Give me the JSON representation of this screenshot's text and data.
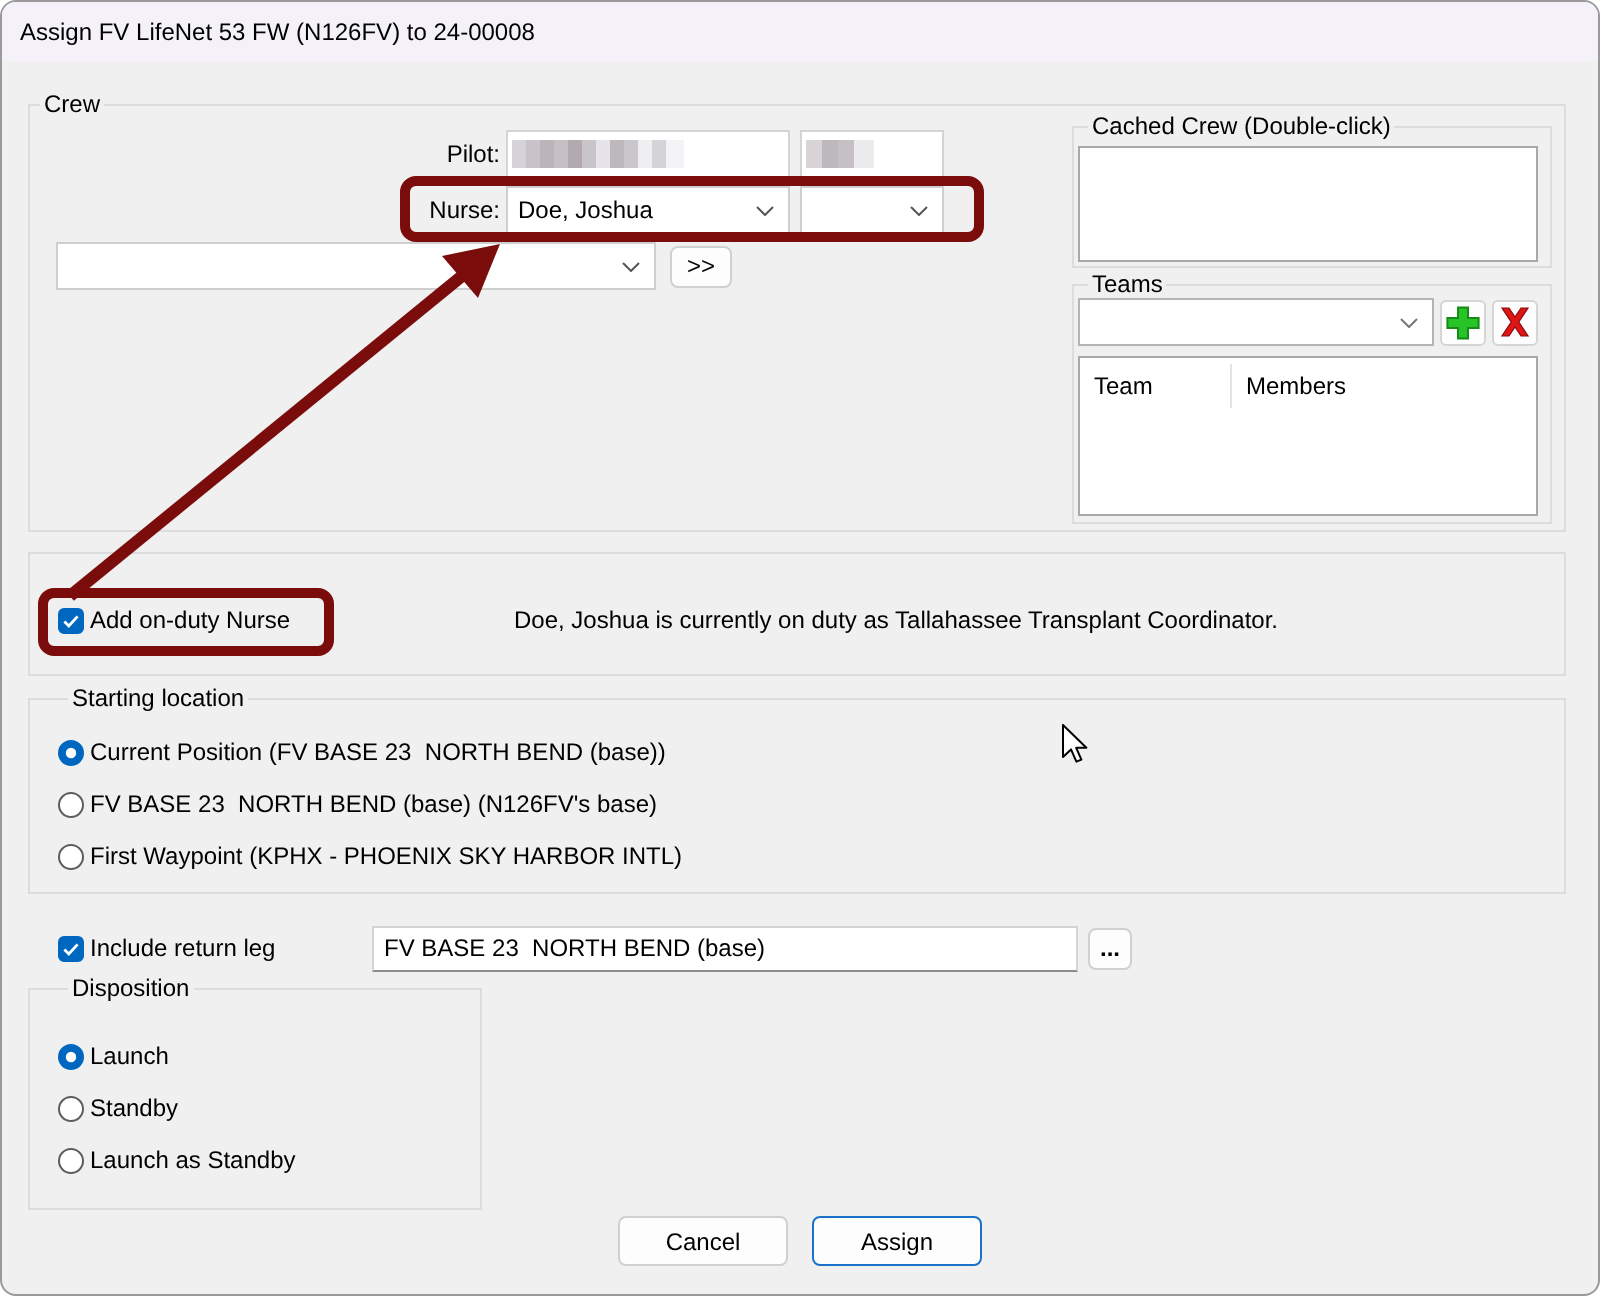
{
  "window": {
    "title": "Assign FV LifeNet 53 FW (N126FV) to 24-00008"
  },
  "crew": {
    "label": "Crew",
    "pilot": {
      "label": "Pilot:",
      "redacted": true
    },
    "nurse": {
      "label": "Nurse:",
      "value": "Doe, Joshua",
      "highlighted": true
    },
    "member_picker": {
      "button": ">>"
    },
    "cached_crew": {
      "label": "Cached Crew (Double-click)"
    },
    "teams": {
      "label": "Teams",
      "columns": [
        "Team",
        "Members"
      ]
    }
  },
  "on_duty": {
    "checkbox": {
      "label": "Add on-duty Nurse",
      "checked": true,
      "highlighted": true
    },
    "message": "Doe, Joshua is currently on duty as Tallahassee Transplant Coordinator."
  },
  "annotation_arrow": true,
  "starting_location": {
    "label": "Starting location",
    "options": [
      {
        "label": "Current Position (FV BASE 23  NORTH BEND (base))",
        "selected": true
      },
      {
        "label": "FV BASE 23  NORTH BEND (base) (N126FV's base)",
        "selected": false
      },
      {
        "label": "First Waypoint (KPHX - PHOENIX SKY HARBOR INTL)",
        "selected": false
      }
    ]
  },
  "return_leg": {
    "label": "Include return leg",
    "checked": true,
    "value": "FV BASE 23  NORTH BEND (base)",
    "button": "..."
  },
  "disposition": {
    "label": "Disposition",
    "options": [
      {
        "label": "Launch",
        "selected": true
      },
      {
        "label": "Standby",
        "selected": false
      },
      {
        "label": "Launch as Standby",
        "selected": false
      }
    ]
  },
  "buttons": [
    {
      "label": "Cancel",
      "default": false
    },
    {
      "label": "Assign",
      "default": true
    }
  ]
}
